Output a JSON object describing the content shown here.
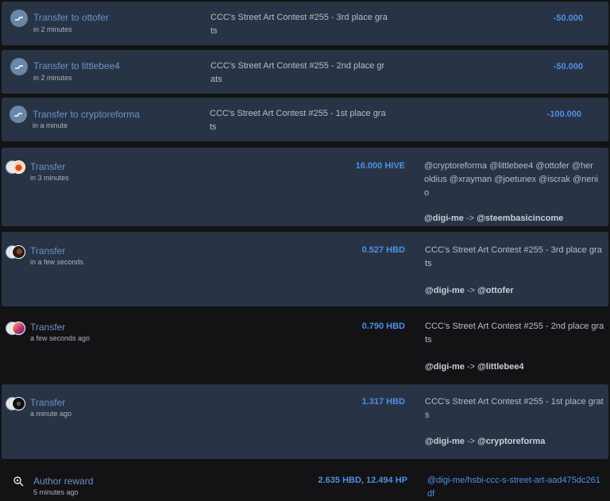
{
  "entries": [
    {
      "title": "Transfer to ottofer",
      "time": "in 2 minutes",
      "memo_line1": "CCC's Street Art Contest #255 - 3rd place gra",
      "memo_line2": "ts",
      "amount": "-50.000"
    },
    {
      "title": "Transfer to littlebee4",
      "time": "in 2 minutes",
      "memo_line1": "CCC's Street Art Contest #255 - 2nd place gr",
      "memo_line2": "ats",
      "amount": "-50.000"
    },
    {
      "title": "Transfer to cryptoreforma",
      "time": "in a minute",
      "memo_line1": "CCC's Street Art Contest #255 - 1st place gra",
      "memo_line2": "ts",
      "amount": "-100.000"
    }
  ],
  "transfers": [
    {
      "title": "Transfer",
      "time": "in 3 minutes",
      "amount": "16.000 HIVE",
      "memo_line1": "@cryptoreforma @littlebee4 @ottofer @her",
      "memo_line2": "oldius @xrayman @joetunex @iscrak @neni",
      "memo_line3": "o",
      "from": "@digi-me",
      "arrow": "->",
      "to": "@steembasicincome"
    },
    {
      "title": "Transfer",
      "time": "in a few seconds",
      "amount": "0.527 HBD",
      "memo_line1": "CCC's Street Art Contest #255 - 3rd place gra",
      "memo_line2": "ts",
      "from": "@digi-me",
      "arrow": "->",
      "to": "@ottofer"
    },
    {
      "title": "Transfer",
      "time": "a few seconds ago",
      "amount": "0.790 HBD",
      "memo_line1": "CCC's Street Art Contest #255 - 2nd place gra",
      "memo_line2": "ts",
      "from": "@digi-me",
      "arrow": "->",
      "to": "@littlebee4"
    },
    {
      "title": "Transfer",
      "time": "a minute ago",
      "amount": "1.317 HBD",
      "memo_line1": "CCC's Street Art Contest #255 - 1st place grat",
      "memo_line2": "s",
      "from": "@digi-me",
      "arrow": "->",
      "to": "@cryptoreforma"
    }
  ],
  "reward": {
    "title": "Author reward",
    "time": "5 minutes ago",
    "amount": "2.635 HBD, 12.494 HP",
    "link_line1": "@digi-me/hsbi-ccc-s-street-art-aad475dc261",
    "link_line2": "df"
  },
  "colors": {
    "card": "#283446",
    "background": "#131315",
    "accent": "#4f8fe8",
    "title": "#6e91c9"
  },
  "icons": {
    "transfer": "transfer-icon",
    "reward": "reward-icon"
  }
}
